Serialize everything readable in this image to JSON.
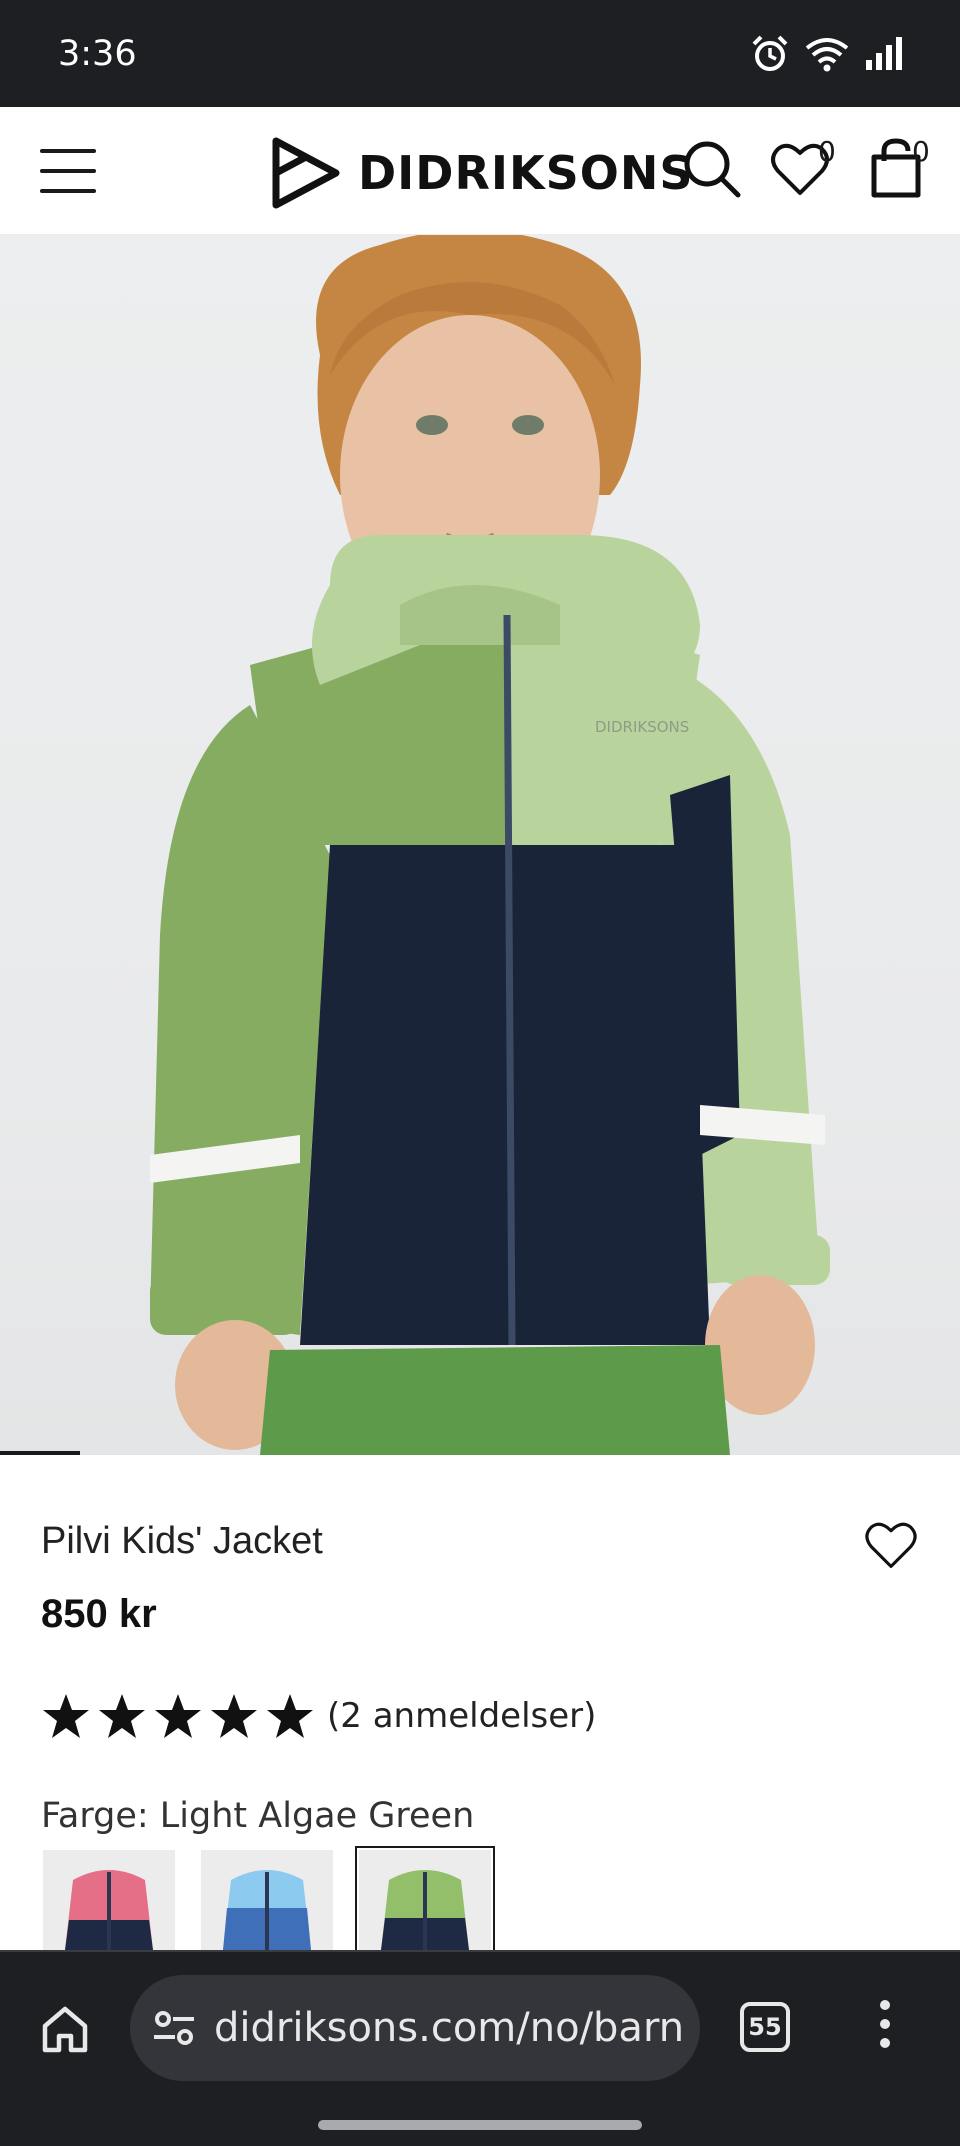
{
  "status_bar": {
    "time": "3:36",
    "icons": [
      "alarm-icon",
      "wifi-icon",
      "signal-icon"
    ]
  },
  "header": {
    "brand": "DIDRIKSONS",
    "wishlist_count": "0",
    "cart_count": "0",
    "icons": [
      "menu-icon",
      "logo-icon",
      "search-icon",
      "heart-icon",
      "bag-icon"
    ]
  },
  "product": {
    "name": "Pilvi Kids' Jacket",
    "price": "850 kr",
    "rating": 5,
    "rating_max": 5,
    "review_count": "(2 anmeldelser)",
    "color_label": "Farge: Light Algae Green",
    "jacket_print": "DIDRIKSONS",
    "swatches": [
      {
        "name": "pink",
        "top": "#e56f86",
        "bottom": "#1e2a44"
      },
      {
        "name": "blue",
        "top": "#8ccaf0",
        "bottom": "#3f6fb8"
      },
      {
        "name": "green",
        "top": "#93bf6b",
        "bottom": "#1e2a44",
        "selected": true
      }
    ]
  },
  "browser": {
    "url": "didriksons.com/no/barn",
    "tab_count": "55"
  },
  "colors": {
    "dark_bar": "#1e1f23",
    "jacket_light_green": "#b9d39c",
    "jacket_green": "#86ac62",
    "jacket_navy": "#1a2438"
  }
}
